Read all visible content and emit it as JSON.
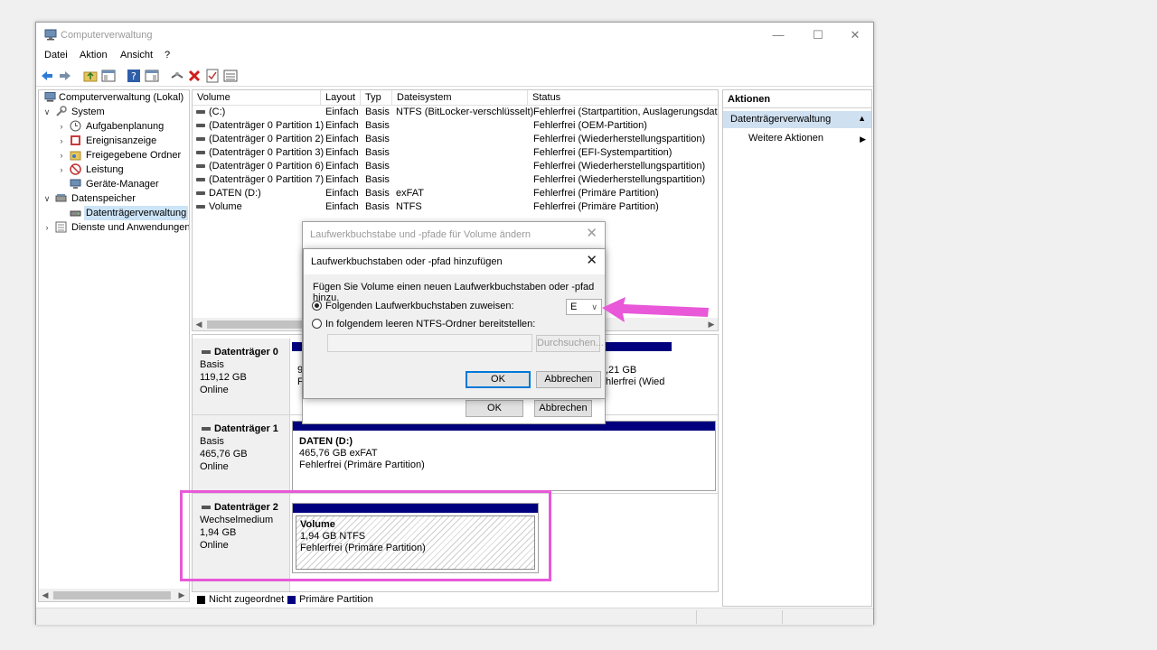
{
  "window": {
    "title": "Computerverwaltung"
  },
  "menu": [
    "Datei",
    "Aktion",
    "Ansicht",
    "?"
  ],
  "tree": {
    "root": "Computerverwaltung (Lokal)",
    "system": "System",
    "system_items": [
      "Aufgabenplanung",
      "Ereignisanzeige",
      "Freigegebene Ordner",
      "Leistung",
      "Geräte-Manager"
    ],
    "storage": "Datenspeicher",
    "storage_items": [
      "Datenträgerverwaltung"
    ],
    "services": "Dienste und Anwendungen"
  },
  "volumes": {
    "columns": [
      "Volume",
      "Layout",
      "Typ",
      "Dateisystem",
      "Status"
    ],
    "rows": [
      [
        "(C:)",
        "Einfach",
        "Basis",
        "NTFS (BitLocker-verschlüsselt)",
        "Fehlerfrei (Startpartition, Auslagerungsdatei,"
      ],
      [
        "(Datenträger 0 Partition 1)",
        "Einfach",
        "Basis",
        "",
        "Fehlerfrei (OEM-Partition)"
      ],
      [
        "(Datenträger 0 Partition 2)",
        "Einfach",
        "Basis",
        "",
        "Fehlerfrei (Wiederherstellungspartition)"
      ],
      [
        "(Datenträger 0 Partition 3)",
        "Einfach",
        "Basis",
        "",
        "Fehlerfrei (EFI-Systempartition)"
      ],
      [
        "(Datenträger 0 Partition 6)",
        "Einfach",
        "Basis",
        "",
        "Fehlerfrei (Wiederherstellungspartition)"
      ],
      [
        "(Datenträger 0 Partition 7)",
        "Einfach",
        "Basis",
        "",
        "Fehlerfrei (Wiederherstellungspartition)"
      ],
      [
        "DATEN (D:)",
        "Einfach",
        "Basis",
        "exFAT",
        "Fehlerfrei (Primäre Partition)"
      ],
      [
        "Volume",
        "Einfach",
        "Basis",
        "NTFS",
        "Fehlerfrei (Primäre Partition)"
      ]
    ]
  },
  "disks": [
    {
      "name": "Datenträger 0",
      "type": "Basis",
      "size": "119,12 GB",
      "state": "Online",
      "partial_left": [
        "9",
        "F"
      ],
      "partial_right": [
        ",21 GB",
        "hlerfrei (Wied"
      ]
    },
    {
      "name": "Datenträger 1",
      "type": "Basis",
      "size": "465,76 GB",
      "state": "Online",
      "partition": {
        "name": "DATEN  (D:)",
        "size": "465,76 GB exFAT",
        "status": "Fehlerfrei (Primäre Partition)"
      }
    },
    {
      "name": "Datenträger 2",
      "type": "Wechselmedium",
      "size": "1,94 GB",
      "state": "Online",
      "partition": {
        "name": "Volume",
        "size": "1,94 GB NTFS",
        "status": "Fehlerfrei (Primäre Partition)"
      }
    }
  ],
  "legend": [
    {
      "label": "Nicht zugeordnet",
      "color": "#000000"
    },
    {
      "label": "Primäre Partition",
      "color": "#00007f"
    }
  ],
  "actions": {
    "header": "Aktionen",
    "selected": "Datenträgerverwaltung",
    "more": "Weitere Aktionen"
  },
  "dialog_back": {
    "title": "Laufwerkbuchstabe und -pfade für Volume ändern",
    "ok": "OK",
    "cancel": "Abbrechen"
  },
  "dialog": {
    "title": "Laufwerkbuchstaben oder -pfad hinzufügen",
    "intro": "Fügen Sie Volume einen neuen Laufwerkbuchstaben oder -pfad hinzu.",
    "option_letter": "Folgenden Laufwerkbuchstaben zuweisen:",
    "letter_value": "E",
    "option_folder": "In folgendem leeren NTFS-Ordner bereitstellen:",
    "browse": "Durchsuchen...",
    "ok": "OK",
    "cancel": "Abbrechen"
  },
  "colors": {
    "accent_arrow": "#e858d8",
    "partition_bar": "#00007f",
    "selection": "#cce4f7"
  }
}
